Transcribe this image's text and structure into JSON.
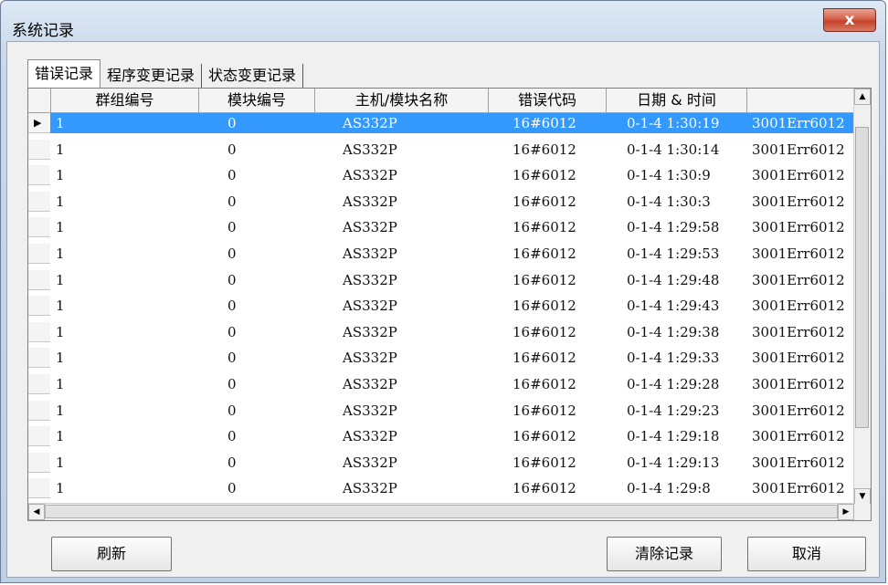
{
  "window": {
    "title": "系统记录",
    "close_label": "x"
  },
  "tabs": [
    {
      "label": "错误记录"
    },
    {
      "label": "程序变更记录"
    },
    {
      "label": "状态变更记录"
    }
  ],
  "columns": [
    "群组编号",
    "模块编号",
    "主机/模块名称",
    "错误代码",
    "日期 & 时间",
    ""
  ],
  "rows": [
    {
      "group": "1",
      "module": "0",
      "name": "AS332P",
      "code": "16#6012",
      "time": "0-1-4 1:30:19",
      "info": "3001Err6012"
    },
    {
      "group": "1",
      "module": "0",
      "name": "AS332P",
      "code": "16#6012",
      "time": "0-1-4 1:30:14",
      "info": "3001Err6012"
    },
    {
      "group": "1",
      "module": "0",
      "name": "AS332P",
      "code": "16#6012",
      "time": "0-1-4 1:30:9",
      "info": "3001Err6012"
    },
    {
      "group": "1",
      "module": "0",
      "name": "AS332P",
      "code": "16#6012",
      "time": "0-1-4 1:30:3",
      "info": "3001Err6012"
    },
    {
      "group": "1",
      "module": "0",
      "name": "AS332P",
      "code": "16#6012",
      "time": "0-1-4 1:29:58",
      "info": "3001Err6012"
    },
    {
      "group": "1",
      "module": "0",
      "name": "AS332P",
      "code": "16#6012",
      "time": "0-1-4 1:29:53",
      "info": "3001Err6012"
    },
    {
      "group": "1",
      "module": "0",
      "name": "AS332P",
      "code": "16#6012",
      "time": "0-1-4 1:29:48",
      "info": "3001Err6012"
    },
    {
      "group": "1",
      "module": "0",
      "name": "AS332P",
      "code": "16#6012",
      "time": "0-1-4 1:29:43",
      "info": "3001Err6012"
    },
    {
      "group": "1",
      "module": "0",
      "name": "AS332P",
      "code": "16#6012",
      "time": "0-1-4 1:29:38",
      "info": "3001Err6012"
    },
    {
      "group": "1",
      "module": "0",
      "name": "AS332P",
      "code": "16#6012",
      "time": "0-1-4 1:29:33",
      "info": "3001Err6012"
    },
    {
      "group": "1",
      "module": "0",
      "name": "AS332P",
      "code": "16#6012",
      "time": "0-1-4 1:29:28",
      "info": "3001Err6012"
    },
    {
      "group": "1",
      "module": "0",
      "name": "AS332P",
      "code": "16#6012",
      "time": "0-1-4 1:29:23",
      "info": "3001Err6012"
    },
    {
      "group": "1",
      "module": "0",
      "name": "AS332P",
      "code": "16#6012",
      "time": "0-1-4 1:29:18",
      "info": "3001Err6012"
    },
    {
      "group": "1",
      "module": "0",
      "name": "AS332P",
      "code": "16#6012",
      "time": "0-1-4 1:29:13",
      "info": "3001Err6012"
    },
    {
      "group": "1",
      "module": "0",
      "name": "AS332P",
      "code": "16#6012",
      "time": "0-1-4 1:29:8",
      "info": "3001Err6012"
    }
  ],
  "selected_row": 0,
  "buttons": {
    "refresh": "刷新",
    "clear": "清除记录",
    "cancel": "取消"
  },
  "icons": {
    "row_indicator": "play-arrow-icon",
    "scroll_up": "up-arrow-icon",
    "scroll_down": "down-arrow-icon",
    "scroll_left": "left-arrow-icon",
    "scroll_right": "right-arrow-icon"
  }
}
